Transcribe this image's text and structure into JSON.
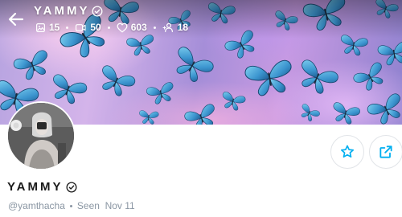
{
  "profile": {
    "display_name": "YAMMY",
    "verified_icon": "verified-badge-icon",
    "username": "@yamthacha",
    "last_seen": "Seen  Nov 11"
  },
  "stats": {
    "posts": "15",
    "videos": "50",
    "likes": "603",
    "subscribers": "18"
  },
  "icons": {
    "back": "arrow-left-icon",
    "posts": "image-icon",
    "videos": "video-icon",
    "likes": "heart-icon",
    "subscribers": "user-icon",
    "favorite": "star-icon",
    "share": "share-icon"
  },
  "colors": {
    "accent": "#00aff0",
    "butterfly": "#4aa8d8",
    "muted_text": "#8a96a3"
  }
}
